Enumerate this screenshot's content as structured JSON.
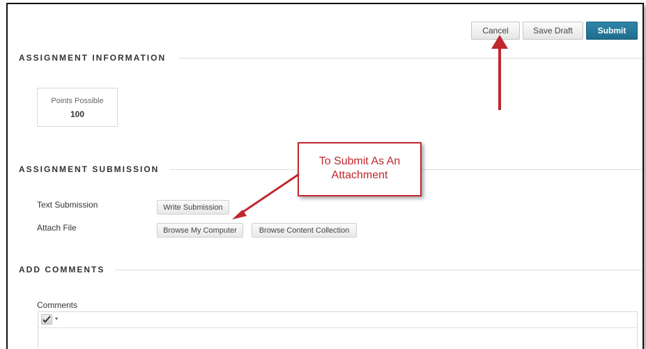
{
  "actions": {
    "cancel_label": "Cancel",
    "save_draft_label": "Save Draft",
    "submit_label": "Submit",
    "submit_color": "#1f6d8c"
  },
  "assignment_information": {
    "heading": "ASSIGNMENT INFORMATION",
    "points_label": "Points Possible",
    "points_value": "100"
  },
  "assignment_submission": {
    "heading": "ASSIGNMENT SUBMISSION",
    "text_submission_label": "Text Submission",
    "write_submission_label": "Write Submission",
    "attach_file_label": "Attach File",
    "browse_computer_label": "Browse My Computer",
    "browse_collection_label": "Browse Content Collection"
  },
  "add_comments": {
    "heading": "ADD COMMENTS",
    "comments_label": "Comments",
    "toolbar_icon": "spellcheck-icon"
  },
  "annotation": {
    "callout_line1": "To Submit As An",
    "callout_line2": "Attachment",
    "color": "#c0272d"
  }
}
